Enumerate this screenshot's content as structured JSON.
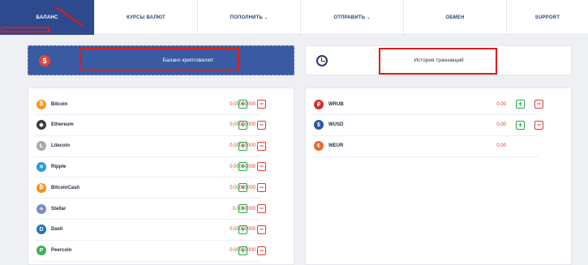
{
  "nav": {
    "items": [
      {
        "label": "БАЛАНС",
        "caret": ""
      },
      {
        "label": "КУРСЫ ВАЛЮТ",
        "caret": ""
      },
      {
        "label": "ПОПОЛНИТЬ",
        "caret": "⌄"
      },
      {
        "label": "ОТПРАВИТЬ",
        "caret": "⌄"
      },
      {
        "label": "ОБМЕН",
        "caret": ""
      },
      {
        "label": "SUPPORT",
        "caret": ""
      }
    ]
  },
  "crypto_card": {
    "icon": "$",
    "title": "Баланс криптовалют"
  },
  "history_card": {
    "title": "История транзакций"
  },
  "crypto": [
    {
      "name": "Bitcoin",
      "amount": "0.00000000",
      "icon": "bitcoin-icon",
      "color": "#f7931a",
      "glyph": "₿"
    },
    {
      "name": "Ethereum",
      "amount": "0.00000000",
      "icon": "ethereum-icon",
      "color": "#3c3c3d",
      "glyph": "◆"
    },
    {
      "name": "Litecoin",
      "amount": "0.00000000",
      "icon": "litecoin-icon",
      "color": "#a6a9aa",
      "glyph": "Ł"
    },
    {
      "name": "Ripple",
      "amount": "0.00000000",
      "icon": "ripple-icon",
      "color": "#2a9bd8",
      "glyph": "✕"
    },
    {
      "name": "BitcoinCash",
      "amount": "0.00000000",
      "icon": "bitcoincash-icon",
      "color": "#f7931a",
      "glyph": "₿"
    },
    {
      "name": "Stellar",
      "amount": "0.0000000",
      "icon": "stellar-icon",
      "color": "#7a8fbf",
      "glyph": "✧"
    },
    {
      "name": "Dash",
      "amount": "0.00000000",
      "icon": "dash-icon",
      "color": "#1c75bc",
      "glyph": "D"
    },
    {
      "name": "Peercoin",
      "amount": "0.00000000",
      "icon": "peercoin-icon",
      "color": "#3cb054",
      "glyph": "P"
    }
  ],
  "fiat": [
    {
      "name": "WRUB",
      "amount": "0.00",
      "icon": "ruble-icon",
      "color": "#d62d2d",
      "glyph": "₽",
      "actions": true
    },
    {
      "name": "WUSD",
      "amount": "0.00",
      "icon": "dollar-icon",
      "color": "#2b57a8",
      "glyph": "$",
      "actions": true
    },
    {
      "name": "WEUR",
      "amount": "0.00",
      "icon": "euro-icon",
      "color": "#e86a2b",
      "glyph": "€",
      "actions": false
    }
  ],
  "buttons": {
    "plus": "+",
    "minus": "−"
  }
}
